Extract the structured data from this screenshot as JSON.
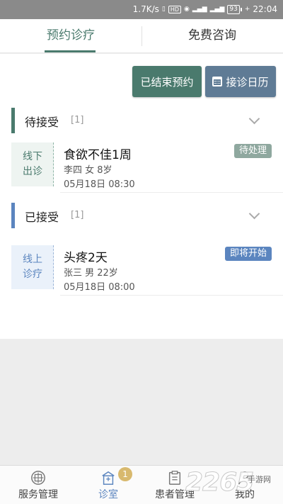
{
  "status_bar": {
    "net_speed": "1.7K/s",
    "hd_label": "HD",
    "battery": "93",
    "time": "22:04"
  },
  "tabs": [
    {
      "label": "预约诊疗"
    },
    {
      "label": "免费咨询"
    }
  ],
  "actions": {
    "ended_label": "已结束预约",
    "calendar_label": "接诊日历"
  },
  "sections": [
    {
      "title": "待接受",
      "count": "[1]",
      "accent": "#4a7a6d",
      "card": {
        "mode_line1": "线下",
        "mode_line2": "出诊",
        "title": "食欲不佳1周",
        "patient": "李四 女 8岁",
        "time": "05月18日 08:30",
        "status": "待处理"
      }
    },
    {
      "title": "已接受",
      "count": "[1]",
      "accent": "#5b85bf",
      "card": {
        "mode_line1": "线上",
        "mode_line2": "诊疗",
        "title": "头疼2天",
        "patient": "张三 男 22岁",
        "time": "05月18日 08:00",
        "status": "即将开始"
      }
    }
  ],
  "bottom_nav": [
    {
      "label": "服务管理",
      "icon": "service-icon"
    },
    {
      "label": "诊室",
      "icon": "clinic-icon",
      "badge": "1",
      "active": true
    },
    {
      "label": "患者管理",
      "icon": "patient-list-icon"
    },
    {
      "label": "我的",
      "icon": "profile-icon"
    }
  ],
  "watermark": {
    "number": "2265",
    "text": "手游网"
  },
  "colors": {
    "primary_green": "#4a7a6d",
    "slate_blue": "#5f7b95",
    "pending_badge": "#8fa89f",
    "upcoming_badge": "#5b85bf",
    "nav_badge": "#d8b96e"
  }
}
